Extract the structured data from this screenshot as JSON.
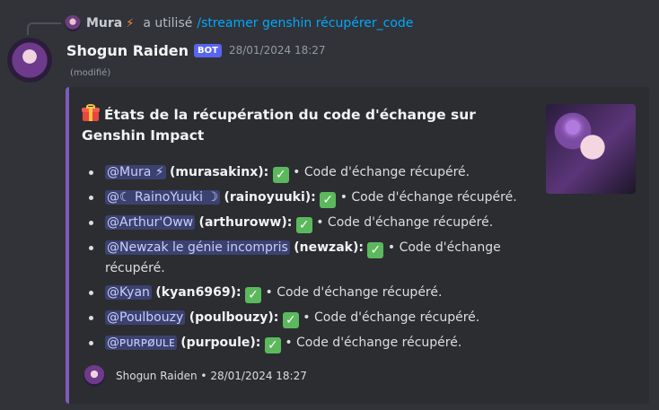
{
  "reply": {
    "username": "Mura",
    "username_emoji": "⚡",
    "used_text": "a utilisé",
    "command": "/streamer genshin récupérer_code"
  },
  "message": {
    "username": "Shogun Raiden",
    "badge": "BOT",
    "timestamp": "28/01/2024 18:27",
    "edited": "(modifié)"
  },
  "embed": {
    "accent_color": "#7e5bbd",
    "title_emoji": "gift-icon",
    "title": "États de la récupération du code d'échange sur Genshin Impact",
    "items": [
      {
        "mention": "@Mura ⚡",
        "username": "(murasakinx):",
        "check": "✓",
        "status": "• Code d'échange récupéré."
      },
      {
        "mention": "@☾ RainoYuuki ☽",
        "username": "(rainoyuuki):",
        "check": "✓",
        "status": "• Code d'échange récupéré."
      },
      {
        "mention": "@Arthur'Oww",
        "username": "(arthuroww):",
        "check": "✓",
        "status": "• Code d'échange récupéré."
      },
      {
        "mention": "@Newzak le génie incompris",
        "username": "(newzak):",
        "check": "✓",
        "status": "• Code d'échange récupéré."
      },
      {
        "mention": "@Kyan",
        "username": "(kyan6969):",
        "check": "✓",
        "status": "• Code d'échange récupéré."
      },
      {
        "mention": "@Poulbouzy",
        "username": "(poulbouzy):",
        "check": "✓",
        "status": "• Code d'échange récupéré."
      },
      {
        "mention": "@ᴘᴜʀᴘøᴜʟᴇ",
        "username": "(purpoule):",
        "check": "✓",
        "status": "• Code d'échange récupéré."
      }
    ],
    "footer": {
      "name": "Shogun Raiden",
      "separator": "•",
      "timestamp": "28/01/2024 18:27"
    }
  }
}
